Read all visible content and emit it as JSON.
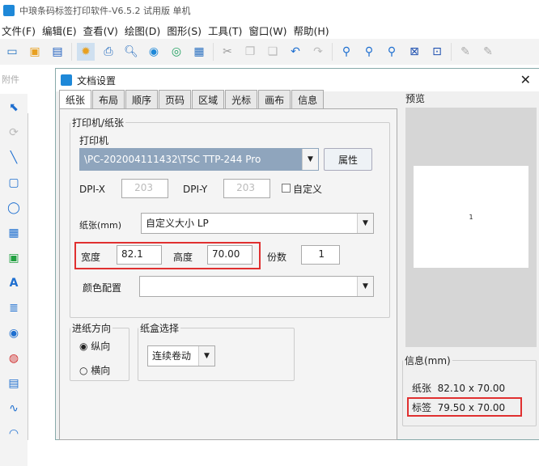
{
  "app": {
    "title": "中琅条码标签打印软件-V6.5.2 试用版 单机"
  },
  "menu": [
    "文件(F)",
    "编辑(E)",
    "查看(V)",
    "绘图(D)",
    "图形(S)",
    "工具(T)",
    "窗口(W)",
    "帮助(H)"
  ],
  "side_label": "附件",
  "dialog": {
    "title": "文档设置",
    "close": "✕",
    "tabs": [
      "纸张",
      "布局",
      "顺序",
      "页码",
      "区域",
      "光标",
      "画布",
      "信息"
    ],
    "printer_group": "打印机/纸张",
    "printer_label": "打印机",
    "printer_value": "\\PC-202004111432\\TSC TTP-244 Pro",
    "properties_btn": "属性",
    "dpi_x_label": "DPI-X",
    "dpi_x": "203",
    "dpi_y_label": "DPI-Y",
    "dpi_y": "203",
    "custom_label": "自定义",
    "paper_label": "纸张(mm)",
    "paper_value": "自定义大小 LP",
    "width_label": "宽度",
    "width_value": "82.1",
    "height_label": "高度",
    "height_value": "70.00",
    "copies_label": "份数",
    "copies_value": "1",
    "color_label": "颜色配置",
    "feed_group": "进纸方向",
    "portrait": "纵向",
    "landscape": "横向",
    "tray_group": "纸盒选择",
    "tray_value": "连续卷动",
    "preview_label": "预览",
    "preview_mark": "1",
    "info_group": "信息(mm)",
    "paper_info_label": "纸张",
    "paper_info": "82.10 x 70.00",
    "label_info_label": "标签",
    "label_info": "79.50 x 70.00"
  }
}
